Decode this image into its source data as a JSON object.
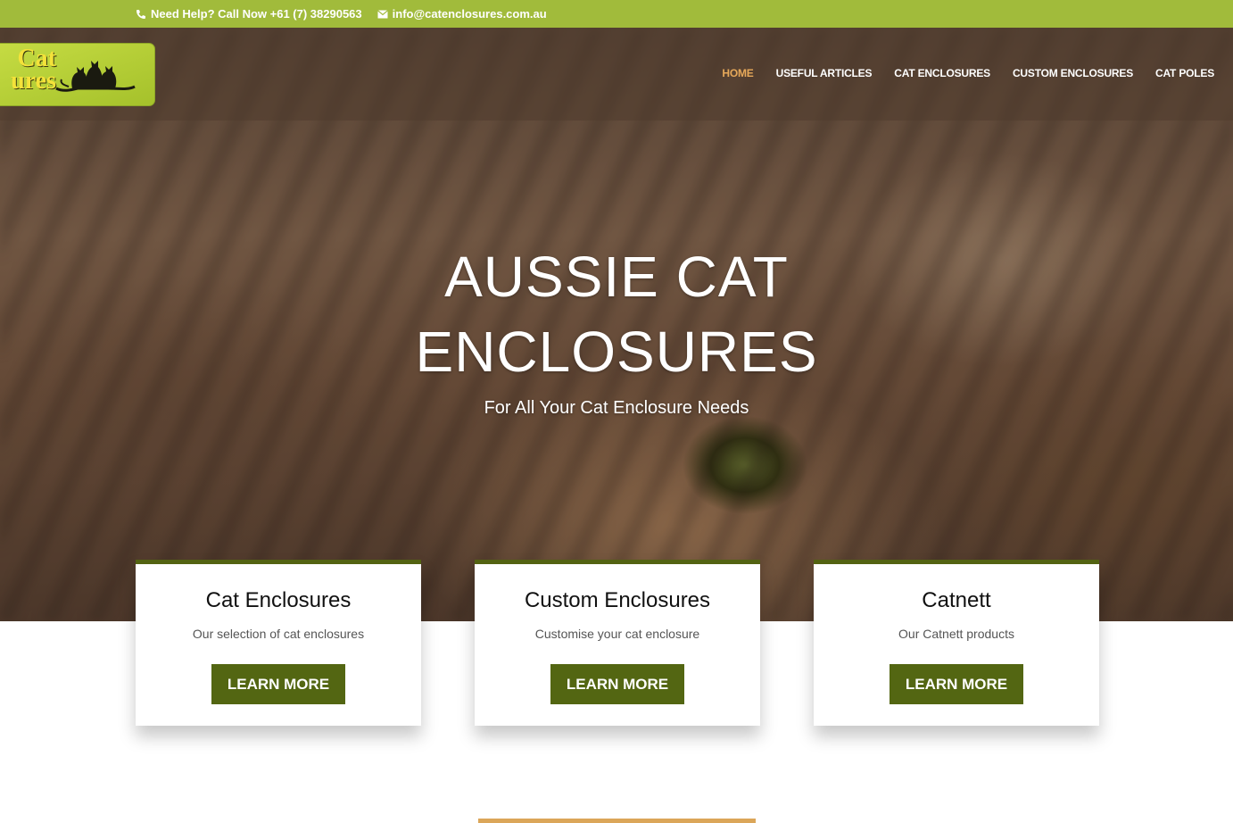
{
  "colors": {
    "topbar": "#a1bb3b",
    "nav_active": "#e7a95a",
    "button": "#536612",
    "card_border": "#536312",
    "accent_bar": "#dba659"
  },
  "topbar": {
    "phone_icon": "phone-icon",
    "phone_text": "Need Help? Call Now +61 (7) 38290563",
    "email_icon": "envelope-icon",
    "email_text": "info@catenclosures.com.au"
  },
  "logo": {
    "line1": "Cat",
    "line2": "ures",
    "image": "cats-silhouette"
  },
  "nav": {
    "items": [
      {
        "label": "HOME",
        "active": true
      },
      {
        "label": "USEFUL ARTICLES",
        "active": false
      },
      {
        "label": "CAT ENCLOSURES",
        "active": false
      },
      {
        "label": "CUSTOM ENCLOSURES",
        "active": false
      },
      {
        "label": "CAT POLES",
        "active": false
      }
    ]
  },
  "hero": {
    "title_line1": "AUSSIE CAT",
    "title_line2": "ENCLOSURES",
    "subtitle": "For All Your Cat Enclosure Needs"
  },
  "cards": [
    {
      "title": "Cat Enclosures",
      "description": "Our selection of cat enclosures",
      "button": "LEARN MORE"
    },
    {
      "title": "Custom Enclosures",
      "description": "Customise your cat enclosure",
      "button": "LEARN MORE"
    },
    {
      "title": "Catnett",
      "description": "Our Catnett products",
      "button": "LEARN MORE"
    }
  ]
}
